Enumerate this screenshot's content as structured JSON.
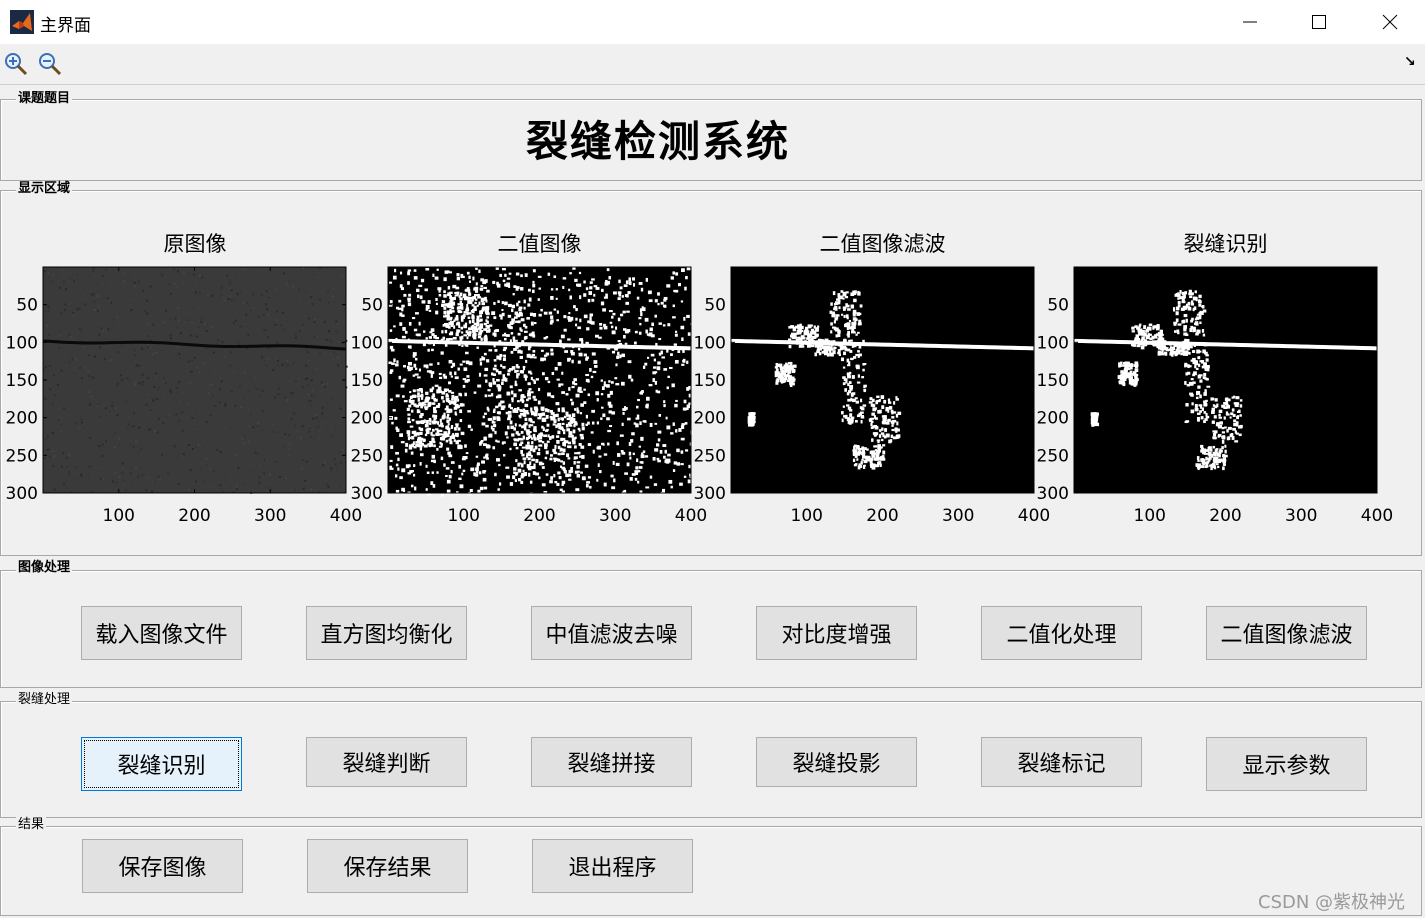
{
  "window": {
    "title": "主界面",
    "controls": {
      "minimize": "—",
      "maximize": "☐",
      "close": "✕"
    }
  },
  "toolbar": {
    "zoom_in": "zoom-in-icon",
    "zoom_out": "zoom-out-icon",
    "dock": "↘"
  },
  "panels": {
    "topic": {
      "legend": "课题题目",
      "title": "裂缝检测系统"
    },
    "display": {
      "legend": "显示区域"
    },
    "image_processing": {
      "legend": "图像处理",
      "buttons": [
        "载入图像文件",
        "直方图均衡化",
        "中值滤波去噪",
        "对比度增强",
        "二值化处理",
        "二值图像滤波"
      ]
    },
    "crack_processing": {
      "legend": "裂缝处理",
      "buttons": [
        "裂缝识别",
        "裂缝判断",
        "裂缝拼接",
        "裂缝投影",
        "裂缝标记",
        "显示参数"
      ]
    },
    "results": {
      "legend": "结果",
      "buttons": [
        "保存图像",
        "保存结果",
        "退出程序"
      ]
    }
  },
  "axes": [
    {
      "title": "原图像",
      "type": "grayscale-image"
    },
    {
      "title": "二值图像",
      "type": "binary-image"
    },
    {
      "title": "二值图像滤波",
      "type": "binary-image-filtered"
    },
    {
      "title": "裂缝识别",
      "type": "binary-image-filtered"
    }
  ],
  "axis_ticks": {
    "x": [
      "100",
      "200",
      "300",
      "400"
    ],
    "y": [
      "50",
      "100",
      "150",
      "200",
      "250",
      "300"
    ]
  },
  "watermark": "CSDN @紫极神光"
}
